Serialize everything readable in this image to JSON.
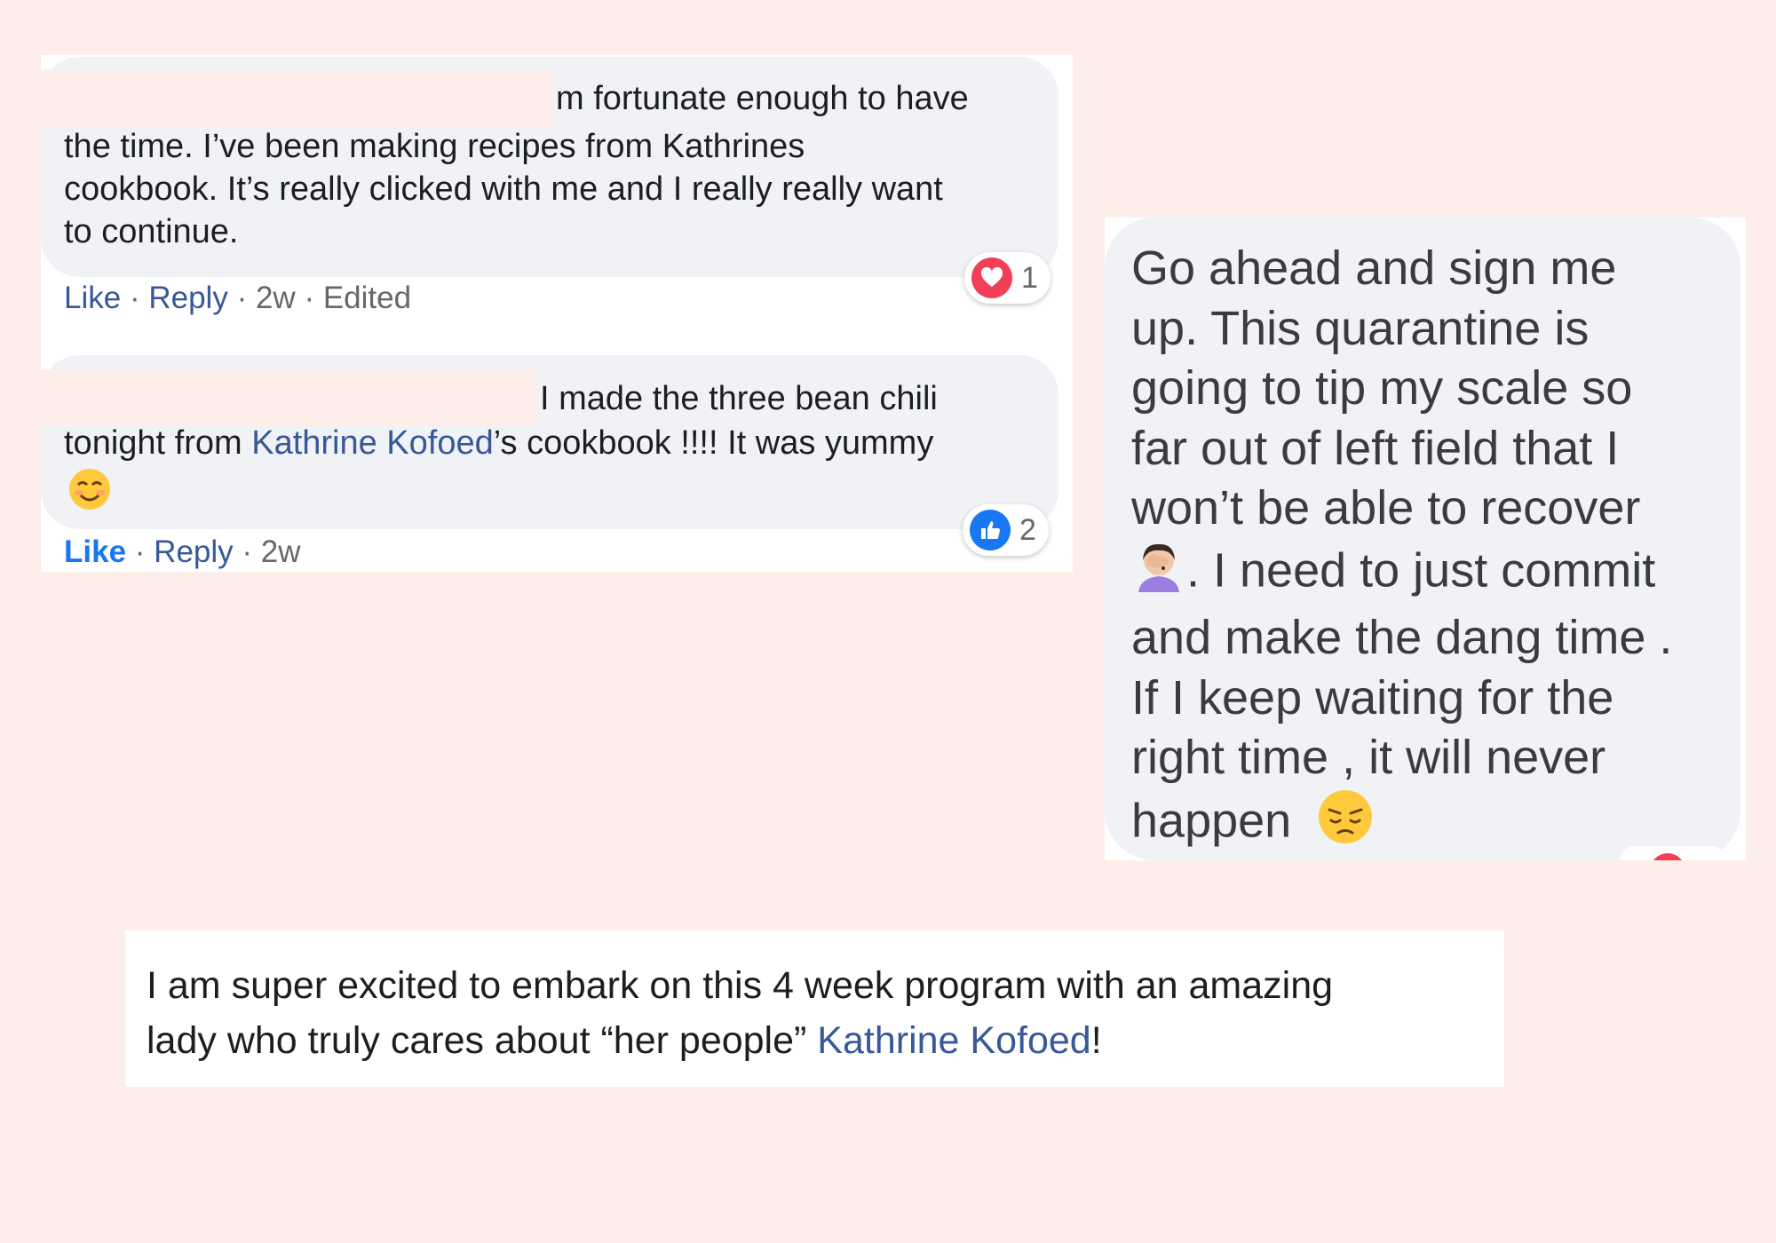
{
  "comment1": {
    "line1": "m fortunate enough to have",
    "line2": "the time. I’ve been making recipes from Kathrines",
    "line3": "cookbook. It’s really clicked with me and I really really want",
    "line4": "to continue.",
    "actions": {
      "like": "Like",
      "reply": "Reply",
      "time": "2w",
      "edited": "Edited"
    },
    "reaction": {
      "icon": "heart-icon",
      "count": "1"
    }
  },
  "comment2": {
    "line1": "I made the three bean chili",
    "line2_before": "tonight from ",
    "mention": "Kathrine Kofoed",
    "line2_after": "’s cookbook !!!! It was yummy",
    "emoji": "smiling-face-icon",
    "actions": {
      "like": "Like",
      "reply": "Reply",
      "time": "2w"
    },
    "reaction": {
      "icon": "thumbs-up-icon",
      "count": "2"
    }
  },
  "comment3": {
    "lines": [
      "Go ahead and sign me",
      "up. This quarantine is",
      "going to tip my scale so",
      "far out of left field that I",
      "won’t be able to recover",
      ". I need to just commit",
      "and make the dang time .",
      "If I keep waiting for the",
      "right time , it will never",
      "happen"
    ],
    "emoji1": "facepalm-icon",
    "emoji2": "pensive-face-icon"
  },
  "comment4": {
    "line1": "I am super excited to embark on this 4 week program with an amazing",
    "line2_before": "lady who truly cares about “her people” ",
    "mention": "Kathrine Kofoed",
    "line2_after": "!"
  },
  "colors": {
    "background": "#fdeeea",
    "bubble": "#f0f2f5",
    "link": "#385898",
    "like_active": "#1877f2",
    "heart": "#f33e58"
  }
}
